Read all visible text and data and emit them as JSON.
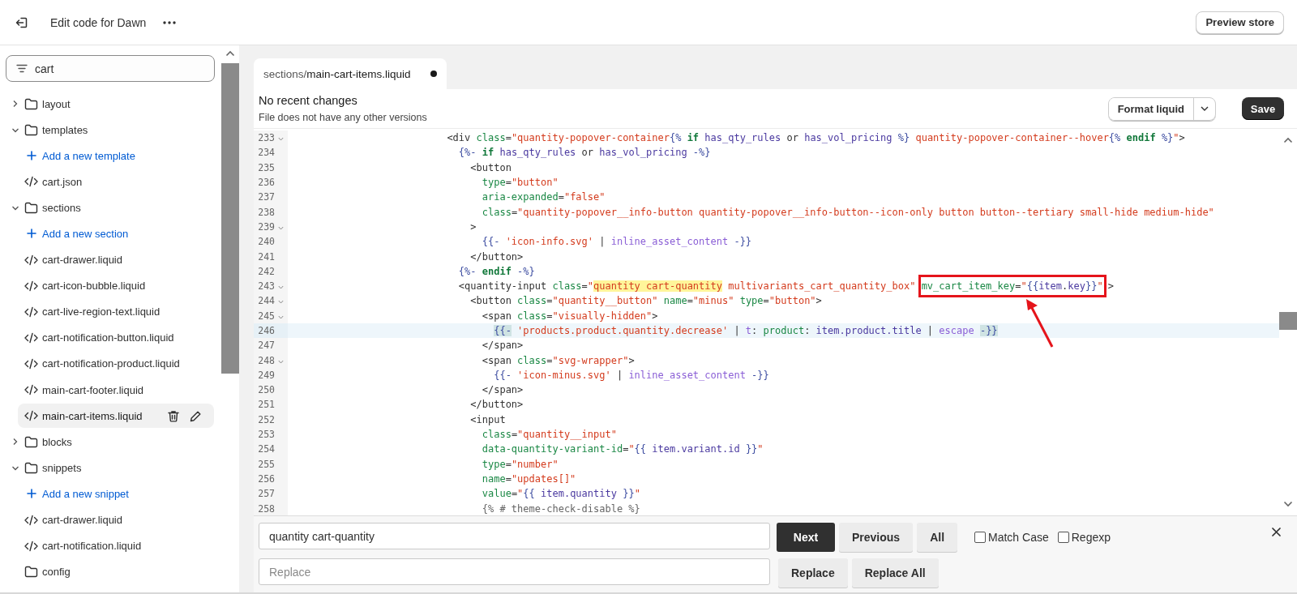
{
  "header": {
    "title": "Edit code for Dawn",
    "preview_button": "Preview store"
  },
  "sidebar": {
    "filter": {
      "value": "cart"
    },
    "tree": [
      {
        "kind": "folder",
        "label": "layout",
        "expanded": false
      },
      {
        "kind": "folder",
        "label": "templates",
        "expanded": true,
        "children": [
          {
            "kind": "add",
            "label": "Add a new template"
          },
          {
            "kind": "file",
            "label": "cart.json",
            "selected": false
          }
        ]
      },
      {
        "kind": "folder",
        "label": "sections",
        "expanded": true,
        "children": [
          {
            "kind": "add",
            "label": "Add a new section"
          },
          {
            "kind": "file",
            "label": "cart-drawer.liquid",
            "selected": false
          },
          {
            "kind": "file",
            "label": "cart-icon-bubble.liquid",
            "selected": false
          },
          {
            "kind": "file",
            "label": "cart-live-region-text.liquid",
            "selected": false
          },
          {
            "kind": "file",
            "label": "cart-notification-button.liquid",
            "selected": false
          },
          {
            "kind": "file",
            "label": "cart-notification-product.liquid",
            "selected": false
          },
          {
            "kind": "file",
            "label": "main-cart-footer.liquid",
            "selected": false
          },
          {
            "kind": "file",
            "label": "main-cart-items.liquid",
            "selected": true
          }
        ]
      },
      {
        "kind": "folder",
        "label": "blocks",
        "expanded": false
      },
      {
        "kind": "folder",
        "label": "snippets",
        "expanded": true,
        "children": [
          {
            "kind": "add",
            "label": "Add a new snippet"
          },
          {
            "kind": "file",
            "label": "cart-drawer.liquid",
            "selected": false
          },
          {
            "kind": "file",
            "label": "cart-notification.liquid",
            "selected": false
          }
        ]
      },
      {
        "kind": "folder",
        "label": "config"
      }
    ]
  },
  "editor": {
    "tab": {
      "label": "sections/**main-cart-items.liquid**",
      "unsaved": true
    },
    "status": {
      "title": "No recent changes",
      "subtitle": "File does not have any other versions"
    },
    "format_button": "Format liquid",
    "save_button": "Save",
    "lines": [
      {
        "number": "233",
        "fold": true,
        "active": false,
        "tokens": [
          {
            "kind": "tag",
            "text": "                        <div "
          },
          {
            "kind": "attr",
            "text": "class"
          },
          {
            "kind": "tag",
            "text": "="
          },
          {
            "kind": "str",
            "text": "\"quantity-popover-container"
          },
          {
            "kind": "delim",
            "text": "{%"
          },
          {
            "kind": "kw",
            "text": " if"
          },
          {
            "kind": "var",
            "text": " has_qty_rules"
          },
          {
            "kind": "plain",
            "text": " or"
          },
          {
            "kind": "var",
            "text": " has_vol_pricing"
          },
          {
            "kind": "delim",
            "text": " %}"
          },
          {
            "kind": "str",
            "text": " quantity-popover-container--hover"
          },
          {
            "kind": "delim",
            "text": "{%"
          },
          {
            "kind": "kw",
            "text": " endif"
          },
          {
            "kind": "delim",
            "text": " %}"
          },
          {
            "kind": "str",
            "text": "\""
          },
          {
            "kind": "tag",
            "text": ">"
          }
        ]
      },
      {
        "number": "234",
        "fold": false,
        "active": false,
        "tokens": [
          {
            "kind": "delim",
            "text": "                          {%-"
          },
          {
            "kind": "kw",
            "text": " if"
          },
          {
            "kind": "var",
            "text": " has_qty_rules"
          },
          {
            "kind": "plain",
            "text": " or"
          },
          {
            "kind": "var",
            "text": " has_vol_pricing"
          },
          {
            "kind": "delim",
            "text": " -%}"
          }
        ]
      },
      {
        "number": "235",
        "fold": false,
        "active": false,
        "tokens": [
          {
            "kind": "tag",
            "text": "                            <button"
          }
        ]
      },
      {
        "number": "236",
        "fold": false,
        "active": false,
        "tokens": [
          {
            "kind": "attr",
            "text": "                              type"
          },
          {
            "kind": "tag",
            "text": "="
          },
          {
            "kind": "str",
            "text": "\"button\""
          }
        ]
      },
      {
        "number": "237",
        "fold": false,
        "active": false,
        "tokens": [
          {
            "kind": "attr",
            "text": "                              aria-expanded"
          },
          {
            "kind": "tag",
            "text": "="
          },
          {
            "kind": "str",
            "text": "\"false\""
          }
        ]
      },
      {
        "number": "238",
        "fold": false,
        "active": false,
        "tokens": [
          {
            "kind": "attr",
            "text": "                              class"
          },
          {
            "kind": "tag",
            "text": "="
          },
          {
            "kind": "str",
            "text": "\"quantity-popover__info-button quantity-popover__info-button--icon-only button button--tertiary small-hide medium-hide\""
          }
        ]
      },
      {
        "number": "239",
        "fold": true,
        "active": false,
        "tokens": [
          {
            "kind": "tag",
            "text": "                            >"
          }
        ]
      },
      {
        "number": "240",
        "fold": false,
        "active": false,
        "tokens": [
          {
            "kind": "delim",
            "text": "                              {{-"
          },
          {
            "kind": "str",
            "text": " 'icon-info.svg'"
          },
          {
            "kind": "plain",
            "text": " |"
          },
          {
            "kind": "filter",
            "text": " inline_asset_content"
          },
          {
            "kind": "delim",
            "text": " -}}"
          }
        ]
      },
      {
        "number": "241",
        "fold": false,
        "active": false,
        "tokens": [
          {
            "kind": "tag",
            "text": "                            </button>"
          }
        ]
      },
      {
        "number": "242",
        "fold": false,
        "active": false,
        "tokens": [
          {
            "kind": "delim",
            "text": "                          {%-"
          },
          {
            "kind": "kw",
            "text": " endif"
          },
          {
            "kind": "delim",
            "text": " -%}"
          }
        ]
      },
      {
        "number": "243",
        "fold": true,
        "active": false,
        "tokens": [
          {
            "kind": "tag",
            "text": "                          <quantity-input "
          },
          {
            "kind": "attr",
            "text": "class"
          },
          {
            "kind": "tag",
            "text": "="
          },
          {
            "kind": "str",
            "text": "\""
          },
          {
            "kind": "str",
            "text": "quantity cart-quantity",
            "search_match": true
          },
          {
            "kind": "str",
            "text": " multivariants_cart_quantity_box\" "
          },
          {
            "kind": "callout",
            "tokens": [
              {
                "kind": "attr",
                "text": "mv_cart_item_key"
              },
              {
                "kind": "tag",
                "text": "="
              },
              {
                "kind": "str",
                "text": "\""
              },
              {
                "kind": "delim",
                "text": "{{"
              },
              {
                "kind": "var",
                "text": "item"
              },
              {
                "kind": "plain",
                "text": "."
              },
              {
                "kind": "var",
                "text": "key"
              },
              {
                "kind": "delim",
                "text": "}}"
              },
              {
                "kind": "str",
                "text": "\""
              }
            ]
          },
          {
            "kind": "tag",
            "text": ">"
          }
        ]
      },
      {
        "number": "244",
        "fold": true,
        "active": false,
        "tokens": [
          {
            "kind": "tag",
            "text": "                            <button "
          },
          {
            "kind": "attr",
            "text": "class"
          },
          {
            "kind": "tag",
            "text": "="
          },
          {
            "kind": "str",
            "text": "\"quantity__button\""
          },
          {
            "kind": "attr",
            "text": " name"
          },
          {
            "kind": "tag",
            "text": "="
          },
          {
            "kind": "str",
            "text": "\"minus\""
          },
          {
            "kind": "attr",
            "text": " type"
          },
          {
            "kind": "tag",
            "text": "="
          },
          {
            "kind": "str",
            "text": "\"button\""
          },
          {
            "kind": "tag",
            "text": ">"
          }
        ]
      },
      {
        "number": "245",
        "fold": true,
        "active": false,
        "tokens": [
          {
            "kind": "tag",
            "text": "                              <span "
          },
          {
            "kind": "attr",
            "text": "class"
          },
          {
            "kind": "tag",
            "text": "="
          },
          {
            "kind": "str",
            "text": "\"visually-hidden\""
          },
          {
            "kind": "tag",
            "text": ">"
          }
        ]
      },
      {
        "number": "246",
        "fold": false,
        "active": true,
        "tokens": [
          {
            "kind": "delim",
            "text": "                                {{-",
            "bracket_match": true
          },
          {
            "kind": "str",
            "text": " 'products.product.quantity.decrease'"
          },
          {
            "kind": "plain",
            "text": " |"
          },
          {
            "kind": "filter",
            "text": " t"
          },
          {
            "kind": "plain",
            "text": ":"
          },
          {
            "kind": "attr",
            "text": " product"
          },
          {
            "kind": "plain",
            "text": ":"
          },
          {
            "kind": "var",
            "text": " item.product.title"
          },
          {
            "kind": "plain",
            "text": " |"
          },
          {
            "kind": "filter",
            "text": " escape"
          },
          {
            "kind": "delim",
            "text": " -}}",
            "bracket_match": true
          }
        ]
      },
      {
        "number": "247",
        "fold": false,
        "active": false,
        "tokens": [
          {
            "kind": "tag",
            "text": "                              </span>"
          }
        ]
      },
      {
        "number": "248",
        "fold": true,
        "active": false,
        "tokens": [
          {
            "kind": "tag",
            "text": "                              <span "
          },
          {
            "kind": "attr",
            "text": "class"
          },
          {
            "kind": "tag",
            "text": "="
          },
          {
            "kind": "str",
            "text": "\"svg-wrapper\""
          },
          {
            "kind": "tag",
            "text": ">"
          }
        ]
      },
      {
        "number": "249",
        "fold": false,
        "active": false,
        "tokens": [
          {
            "kind": "delim",
            "text": "                                {{-"
          },
          {
            "kind": "str",
            "text": " 'icon-minus.svg'"
          },
          {
            "kind": "plain",
            "text": " |"
          },
          {
            "kind": "filter",
            "text": " inline_asset_content"
          },
          {
            "kind": "delim",
            "text": " -}}"
          }
        ]
      },
      {
        "number": "250",
        "fold": false,
        "active": false,
        "tokens": [
          {
            "kind": "tag",
            "text": "                              </span>"
          }
        ]
      },
      {
        "number": "251",
        "fold": false,
        "active": false,
        "tokens": [
          {
            "kind": "tag",
            "text": "                            </button>"
          }
        ]
      },
      {
        "number": "252",
        "fold": false,
        "active": false,
        "tokens": [
          {
            "kind": "tag",
            "text": "                            <input"
          }
        ]
      },
      {
        "number": "253",
        "fold": false,
        "active": false,
        "tokens": [
          {
            "kind": "attr",
            "text": "                              class"
          },
          {
            "kind": "tag",
            "text": "="
          },
          {
            "kind": "str",
            "text": "\"quantity__input\""
          }
        ]
      },
      {
        "number": "254",
        "fold": false,
        "active": false,
        "tokens": [
          {
            "kind": "attr",
            "text": "                              data-quantity-variant-id"
          },
          {
            "kind": "tag",
            "text": "="
          },
          {
            "kind": "str",
            "text": "\""
          },
          {
            "kind": "delim",
            "text": "{{"
          },
          {
            "kind": "var",
            "text": " item.variant.id"
          },
          {
            "kind": "delim",
            "text": " }}"
          },
          {
            "kind": "str",
            "text": "\""
          }
        ]
      },
      {
        "number": "255",
        "fold": false,
        "active": false,
        "tokens": [
          {
            "kind": "attr",
            "text": "                              type"
          },
          {
            "kind": "tag",
            "text": "="
          },
          {
            "kind": "str",
            "text": "\"number\""
          }
        ]
      },
      {
        "number": "256",
        "fold": false,
        "active": false,
        "tokens": [
          {
            "kind": "attr",
            "text": "                              name"
          },
          {
            "kind": "tag",
            "text": "="
          },
          {
            "kind": "str",
            "text": "\"updates[]\""
          }
        ]
      },
      {
        "number": "257",
        "fold": false,
        "active": false,
        "tokens": [
          {
            "kind": "attr",
            "text": "                              value"
          },
          {
            "kind": "tag",
            "text": "="
          },
          {
            "kind": "str",
            "text": "\""
          },
          {
            "kind": "delim",
            "text": "{{"
          },
          {
            "kind": "var",
            "text": " item.quantity"
          },
          {
            "kind": "delim",
            "text": " }}"
          },
          {
            "kind": "str",
            "text": "\""
          }
        ]
      },
      {
        "number": "258",
        "fold": false,
        "active": false,
        "tokens": [
          {
            "kind": "comment",
            "text": "                              {% # theme-check-disable %}"
          }
        ]
      }
    ]
  },
  "find_bar": {
    "find": {
      "value": "quantity cart-quantity"
    },
    "replace": {
      "placeholder": "Replace"
    },
    "find_buttons": [
      {
        "label": "Next",
        "kind": "primary"
      },
      {
        "label": "Previous",
        "kind": "secondary"
      },
      {
        "label": "All",
        "kind": "secondary"
      }
    ],
    "options": [
      {
        "label": "Match Case",
        "checked": false
      },
      {
        "label": "Regexp",
        "checked": false
      }
    ],
    "replace_buttons": [
      {
        "label": "Replace"
      },
      {
        "label": "Replace All"
      }
    ]
  }
}
